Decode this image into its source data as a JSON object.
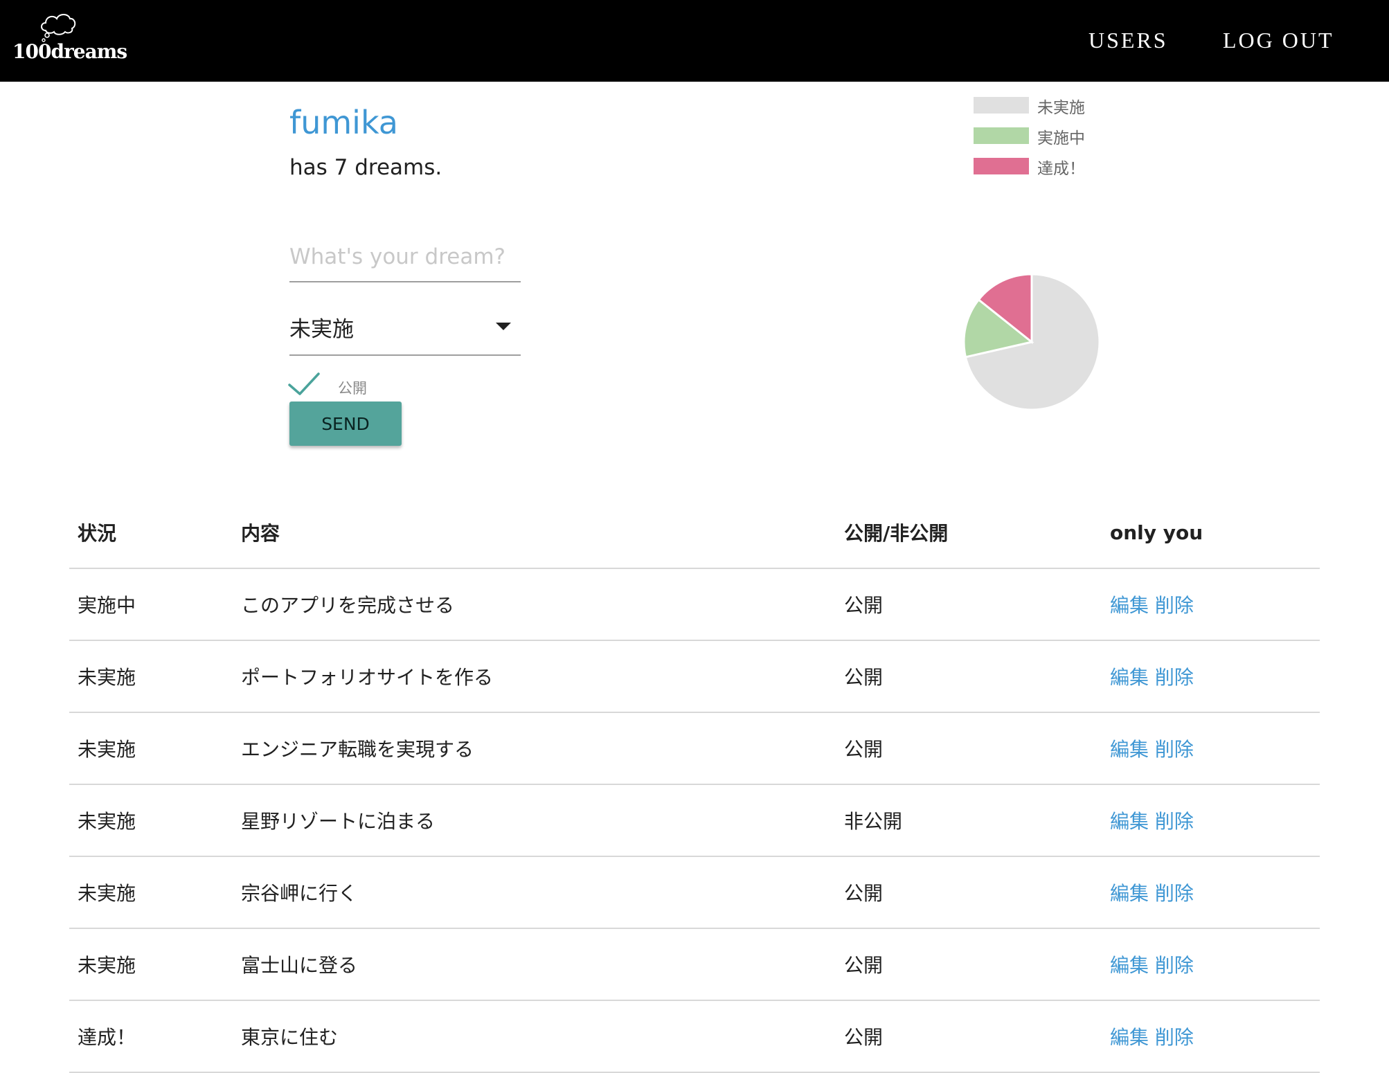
{
  "nav": {
    "logo_text": "100dreams",
    "users_label": "USERS",
    "logout_label": "LOG OUT"
  },
  "profile": {
    "user_name": "fumika",
    "dream_count_text": "has 7 dreams."
  },
  "form": {
    "dream_placeholder": "What's your dream?",
    "dream_value": "",
    "status_value": "未実施",
    "public_label": "公開",
    "public_checked": true,
    "send_label": "SEND"
  },
  "chart_data": {
    "type": "pie",
    "labels": [
      "未実施",
      "実施中",
      "達成！"
    ],
    "values": [
      5,
      1,
      1
    ],
    "colors": [
      "#e0e0e0",
      "#b1d7a6",
      "#e06f92"
    ],
    "legend_position": "top"
  },
  "table": {
    "headers": [
      "状況",
      "内容",
      "公開/非公開",
      "only you"
    ],
    "edit_label": "編集",
    "delete_label": "削除",
    "rows": [
      {
        "status": "実施中",
        "content": "このアプリを完成させる",
        "visibility": "公開"
      },
      {
        "status": "未実施",
        "content": "ポートフォリオサイトを作る",
        "visibility": "公開"
      },
      {
        "status": "未実施",
        "content": "エンジニア転職を実現する",
        "visibility": "公開"
      },
      {
        "status": "未実施",
        "content": "星野リゾートに泊まる",
        "visibility": "非公開"
      },
      {
        "status": "未実施",
        "content": "宗谷岬に行く",
        "visibility": "公開"
      },
      {
        "status": "未実施",
        "content": "富士山に登る",
        "visibility": "公開"
      },
      {
        "status": "達成！",
        "content": "東京に住む",
        "visibility": "公開"
      }
    ]
  },
  "colors": {
    "navbar_bg": "#000000",
    "link": "#3f97d4",
    "button": "#54a49b",
    "checkmark": "#4aa39b"
  },
  "icons": {
    "logo": "cloud-icon",
    "checkbox": "checkmark-icon",
    "select": "caret-down-icon"
  }
}
